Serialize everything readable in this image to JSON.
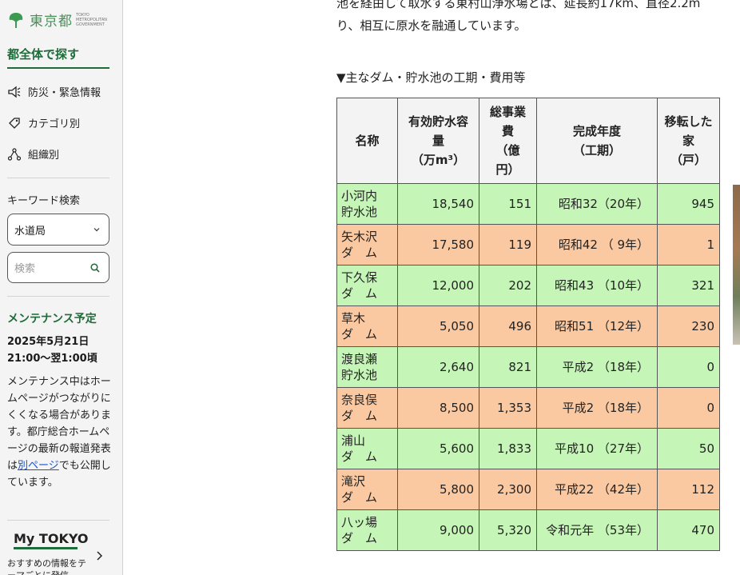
{
  "sidebar": {
    "logo_text": "東京都",
    "logo_sub": "TOKYO METROPOLITAN GOVERNMENT",
    "section_title": "都全体で探す",
    "nav": [
      {
        "label": "防災・緊急情報",
        "icon": "megaphone-icon"
      },
      {
        "label": "カテゴリ別",
        "icon": "tag-icon"
      },
      {
        "label": "組織別",
        "icon": "org-chart-icon"
      }
    ],
    "keyword_label": "キーワード検索",
    "select_value": "水道局",
    "search_placeholder": "検索",
    "maintenance": {
      "title": "メンテナンス予定",
      "date_line1": "2025年5月21日",
      "date_line2": "21:00〜翌1:00頃",
      "body_before": "メンテナンス中はホームページがつながりにくくなる場合があります。都庁総合ホームページの最新の報道発表は",
      "link": "別ページ",
      "body_after": "でも公開しています。"
    },
    "mytokyo": {
      "logo": "My TOKYO",
      "text": "おすすめの情報をテーマごとに発信"
    }
  },
  "main": {
    "intro_line1": "池を経由して取水する東村山浄水場とは、延長約17km、直径2.2m",
    "intro_line2": "り、相互に原水を融通しています。",
    "caption": "▼主なダム・貯水池の工期・費用等",
    "table": {
      "headers": [
        "名称",
        "有効貯水容量（万m³）",
        "総事業費（億円）",
        "完成年度（工期）",
        "移転した家（戸）"
      ],
      "header_lines": [
        [
          "名称"
        ],
        [
          "有効貯水容",
          "量",
          "（万m³）"
        ],
        [
          "総事業",
          "費",
          "（億",
          "円）"
        ],
        [
          "完成年度",
          "（工期）"
        ],
        [
          "移転した",
          "家",
          "（戸）"
        ]
      ],
      "rows": [
        {
          "name1": "小河内",
          "name2": "貯水池",
          "capacity": "18,540",
          "cost": "151",
          "year": "昭和32（20年）",
          "houses": "945",
          "color": "green"
        },
        {
          "name1": "矢木沢",
          "name2": "ダ　ム",
          "capacity": "17,580",
          "cost": "119",
          "year": "昭和42 （ 9年）",
          "houses": "1",
          "color": "orange"
        },
        {
          "name1": "下久保",
          "name2": "ダ　ム",
          "capacity": "12,000",
          "cost": "202",
          "year": "昭和43 （10年）",
          "houses": "321",
          "color": "green"
        },
        {
          "name1": "草木",
          "name2": "ダ　ム",
          "capacity": "5,050",
          "cost": "496",
          "year": "昭和51 （12年）",
          "houses": "230",
          "color": "orange"
        },
        {
          "name1": "渡良瀬",
          "name2": "貯水池",
          "capacity": "2,640",
          "cost": "821",
          "year": "平成2 （18年）",
          "houses": "0",
          "color": "green"
        },
        {
          "name1": "奈良俣",
          "name2": "ダ　ム",
          "capacity": "8,500",
          "cost": "1,353",
          "year": "平成2 （18年）",
          "houses": "0",
          "color": "orange"
        },
        {
          "name1": "浦山",
          "name2": "ダ　ム",
          "capacity": "5,600",
          "cost": "1,833",
          "year": "平成10 （27年）",
          "houses": "50",
          "color": "green"
        },
        {
          "name1": "滝沢",
          "name2": "ダ　ム",
          "capacity": "5,800",
          "cost": "2,300",
          "year": "平成22 （42年）",
          "houses": "112",
          "color": "orange"
        },
        {
          "name1": "八ッ場",
          "name2": "ダ　ム",
          "capacity": "9,000",
          "cost": "5,320",
          "year": "令和元年 （53年）",
          "houses": "470",
          "color": "green"
        }
      ]
    }
  },
  "colors": {
    "brand_green": "#1f6b3a",
    "row_green": "#c6f5b8",
    "row_orange": "#fac9a2",
    "link": "#1a53c6"
  }
}
